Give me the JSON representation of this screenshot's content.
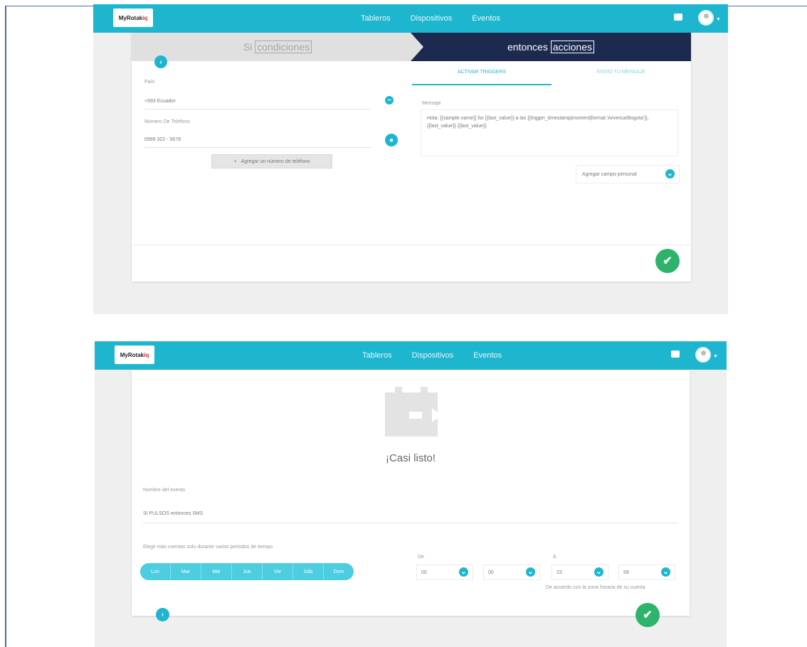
{
  "colors": {
    "topbar": "#1eb6cf",
    "accent": "#1eb6cf",
    "dark_step": "#1b2a4e",
    "success": "#2db46a",
    "logo_red": "#d2232a"
  },
  "icons": {
    "inbox": "inbox-icon",
    "avatar": "user-avatar-icon",
    "back": "chevron-left-icon",
    "confirm": "check-icon",
    "add": "plus-icon",
    "remove": "minus-icon",
    "dropdown": "chevron-down-icon"
  },
  "screen1": {
    "logo": {
      "prefix": "MyRotak",
      "suffix": "iq"
    },
    "nav": [
      "Tableros",
      "Dispositivos",
      "Eventos"
    ],
    "steps": {
      "left": {
        "label": "Si",
        "bracket": "condiciones"
      },
      "right": {
        "label": "entonces",
        "bracket": "acciones"
      }
    },
    "form": {
      "country_label": "País",
      "country_value": "+593 Ecuador",
      "phone_label": "Número De Teléfono",
      "phone_value": "0999 322 - 5678",
      "add_phone_button": "Agregar un número de teléfono"
    },
    "tabs": [
      "ACTIVAR TRIGGERS",
      "ENVÍO TU MENSAJE"
    ],
    "message_label": "Mensaje",
    "message_value": "Hola: {{sample.name}} for {{last_value}} a las {{trigger_timestamp|moment|format:'America/Bogota'}}, {{last_value}} {{last_value}}",
    "custom_field_dropdown": "Agregar campo personal"
  },
  "screen2": {
    "logo": {
      "prefix": "MyRotak",
      "suffix": "iq"
    },
    "nav": [
      "Tableros",
      "Dispositivos",
      "Eventos"
    ],
    "heading": "¡Casi listo!",
    "rule_name_label": "Nombre del evento",
    "rule_name_value": "SI PULSOS entonces SMS",
    "schedule_label": "Elegir más cuentas solo durante varios periodos de tiempo",
    "days": [
      "Lun",
      "Mar",
      "Mié",
      "Jue",
      "Vie",
      "Sáb",
      "Dom"
    ],
    "from_label": "De",
    "to_label": "A",
    "from_hour": "00",
    "from_minute": "00",
    "to_hour": "23",
    "to_minute": "59",
    "timezone_note": "De acuerdo con la zona horaria de su cuenta"
  }
}
